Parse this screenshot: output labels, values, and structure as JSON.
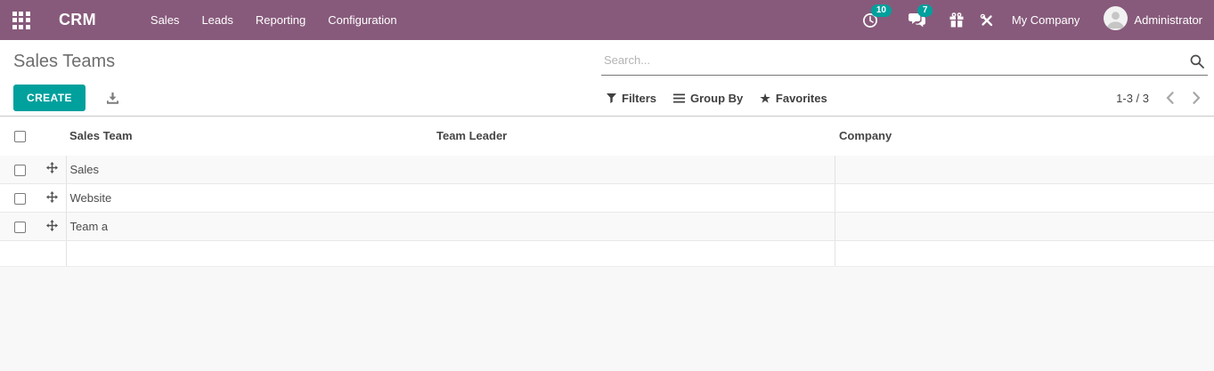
{
  "navbar": {
    "brand": "CRM",
    "menu": [
      "Sales",
      "Leads",
      "Reporting",
      "Configuration"
    ],
    "activity_count": "10",
    "message_count": "7",
    "company": "My Company",
    "user": "Administrator"
  },
  "control_panel": {
    "title": "Sales Teams",
    "search_placeholder": "Search...",
    "create_label": "CREATE",
    "filters_label": "Filters",
    "group_by_label": "Group By",
    "favorites_label": "Favorites",
    "pager": "1-3 / 3"
  },
  "table": {
    "columns": [
      "Sales Team",
      "Team Leader",
      "Company"
    ],
    "rows": [
      {
        "name": "Sales",
        "leader": "",
        "company": ""
      },
      {
        "name": "Website",
        "leader": "",
        "company": ""
      },
      {
        "name": "Team a",
        "leader": "",
        "company": ""
      }
    ]
  },
  "colors": {
    "navbar": "#875A7B",
    "accent": "#00A09D",
    "stripe": "#f9f9f9"
  }
}
